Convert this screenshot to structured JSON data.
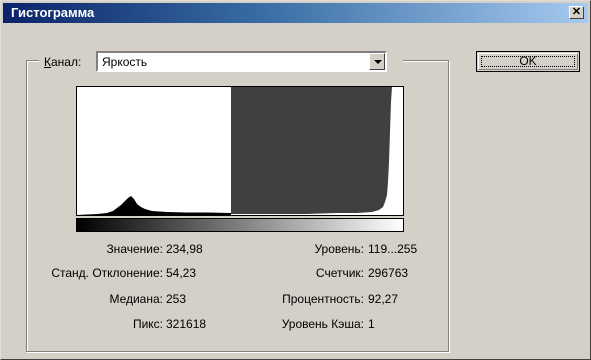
{
  "window": {
    "title": "Гистограмма",
    "close_glyph": "✕"
  },
  "channel": {
    "label_prefix": "",
    "label_underlined": "К",
    "label_rest": "анал:",
    "value": "Яркость"
  },
  "ok_button": {
    "label": "OK"
  },
  "stats_left": [
    {
      "label": "Значение:",
      "value": "234,98"
    },
    {
      "label": "Станд. Отклонение:",
      "value": "54,23"
    },
    {
      "label": "Медиана:",
      "value": "253"
    },
    {
      "label": "Пикс:",
      "value": "321618"
    }
  ],
  "stats_right": [
    {
      "label": "Уровень:",
      "value": "119...255"
    },
    {
      "label": "Счетчик:",
      "value": "296763"
    },
    {
      "label": "Процентность:",
      "value": "92,27"
    },
    {
      "label": "Уровень Кэша:",
      "value": "1"
    }
  ],
  "histogram": {
    "selection_range": [
      119,
      255
    ],
    "fill_color": "#000000",
    "selection_color": "#404040"
  }
}
